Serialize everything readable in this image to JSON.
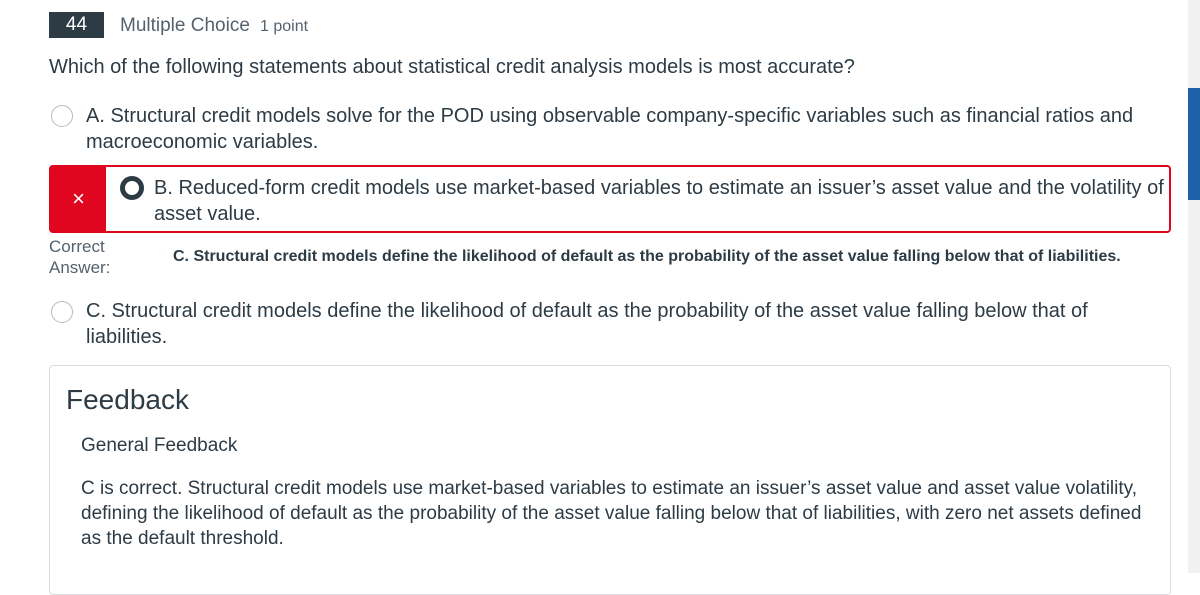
{
  "question": {
    "number": "44",
    "type": "Multiple Choice",
    "points": "1 point",
    "text": "Which of the following statements about statistical credit analysis models is most accurate?"
  },
  "options": [
    {
      "label": "A. Structural credit models solve for the POD using observable company-specific variables such as financial ratios and macroeconomic variables.",
      "selected": false
    },
    {
      "label": "B. Reduced-form credit models use market-based variables to estimate an issuer’s asset value and the volatility of asset value.",
      "selected": true,
      "result": "incorrect"
    },
    {
      "label": "C. Structural credit models define the likelihood of default as the probability of the asset value falling below that of liabilities.",
      "selected": false
    }
  ],
  "wrong_mark": "×",
  "correct_answer": {
    "label": "Correct Answer:",
    "text": "C. Structural credit models define the likelihood of default as the probability of the asset value falling below that of liabilities."
  },
  "feedback": {
    "title": "Feedback",
    "subtitle": "General Feedback",
    "body": "C is correct. Structural credit models use market-based variables to estimate an issuer’s asset value and asset value volatility, defining the likelihood of default as the probability of the asset value falling below that of liabilities, with zero net assets defined as the default threshold."
  },
  "colors": {
    "incorrect": "#e0061f",
    "text": "#2d3b45",
    "scroll_thumb": "#1f5fa8"
  }
}
